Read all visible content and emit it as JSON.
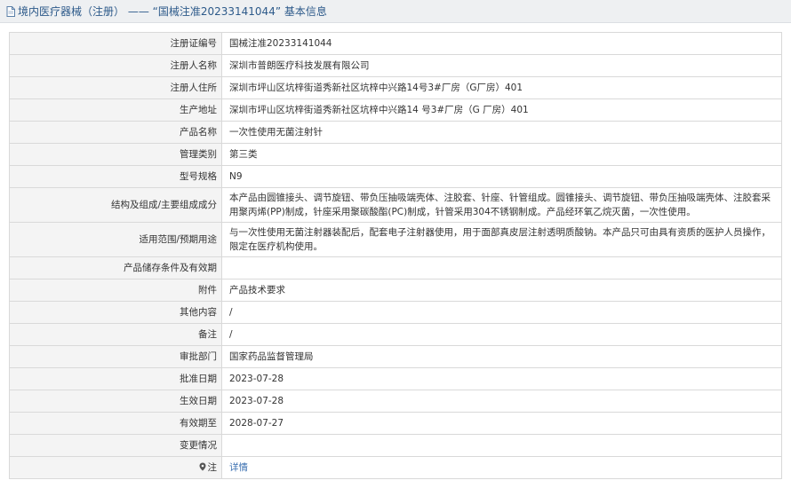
{
  "header": {
    "icon": "document-icon",
    "title": "境内医疗器械（注册） —— “国械注准20233141044” 基本信息"
  },
  "rows": [
    {
      "label": "注册证编号",
      "value": "国械注准20233141044"
    },
    {
      "label": "注册人名称",
      "value": "深圳市普朗医疗科技发展有限公司"
    },
    {
      "label": "注册人住所",
      "value": "深圳市坪山区坑梓街道秀新社区坑梓中兴路14号3#厂房（G厂房）401"
    },
    {
      "label": "生产地址",
      "value": "深圳市坪山区坑梓街道秀新社区坑梓中兴路14 号3#厂房（G 厂房）401"
    },
    {
      "label": "产品名称",
      "value": "一次性使用无菌注射针"
    },
    {
      "label": "管理类别",
      "value": "第三类"
    },
    {
      "label": "型号规格",
      "value": "N9"
    },
    {
      "label": "结构及组成/主要组成成分",
      "value": "本产品由圆锥接头、调节旋钮、带负压抽吸端壳体、注胶套、针座、针管组成。圆锥接头、调节旋钮、带负压抽吸端壳体、注胶套采用聚丙烯(PP)制成，针座采用聚碳酸酯(PC)制成，针管采用304不锈钢制成。产品经环氧乙烷灭菌，一次性使用。"
    },
    {
      "label": "适用范围/预期用途",
      "value": "与一次性使用无菌注射器装配后，配套电子注射器使用，用于面部真皮层注射透明质酸钠。本产品只可由具有资质的医护人员操作，限定在医疗机构使用。"
    },
    {
      "label": "产品储存条件及有效期",
      "value": ""
    },
    {
      "label": "附件",
      "value": "产品技术要求"
    },
    {
      "label": "其他内容",
      "value": "/"
    },
    {
      "label": "备注",
      "value": "/"
    },
    {
      "label": "审批部门",
      "value": "国家药品监督管理局"
    },
    {
      "label": "批准日期",
      "value": "2023-07-28"
    },
    {
      "label": "生效日期",
      "value": "2023-07-28"
    },
    {
      "label": "有效期至",
      "value": "2028-07-27"
    },
    {
      "label": "变更情况",
      "value": ""
    }
  ],
  "note_row": {
    "icon": "note-icon",
    "label": "注",
    "link_text": "详情"
  },
  "colors": {
    "title_text": "#2d5a8a",
    "label_bg": "#f4f4f4",
    "border": "#d9d9d9",
    "link": "#3a6fb0"
  }
}
